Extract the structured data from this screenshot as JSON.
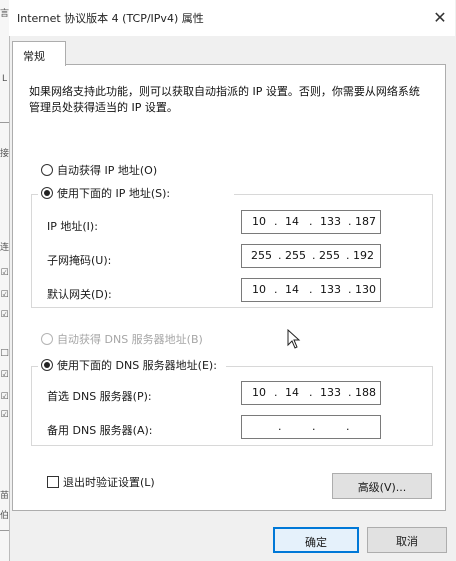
{
  "window": {
    "title": "Internet 协议版本 4 (TCP/IPv4) 属性",
    "close_glyph": "✕"
  },
  "tabs": [
    {
      "label": "常规"
    }
  ],
  "intro": "如果网络支持此功能，则可以获取自动指派的 IP 设置。否则，你需要从网络系统管理员处获得适当的 IP 设置。",
  "ip": {
    "auto_label": "自动获得 IP 地址(O)",
    "manual_label": "使用下面的 IP 地址(S):",
    "fields": [
      {
        "label": "IP 地址(I):",
        "octets": [
          "10",
          "14",
          "133",
          "187"
        ]
      },
      {
        "label": "子网掩码(U):",
        "octets": [
          "255",
          "255",
          "255",
          "192"
        ]
      },
      {
        "label": "默认网关(D):",
        "octets": [
          "10",
          "14",
          "133",
          "130"
        ]
      }
    ]
  },
  "dns": {
    "auto_label": "自动获得 DNS 服务器地址(B)",
    "manual_label": "使用下面的 DNS 服务器地址(E):",
    "fields": [
      {
        "label": "首选 DNS 服务器(P):",
        "octets": [
          "10",
          "14",
          "133",
          "188"
        ]
      },
      {
        "label": "备用 DNS 服务器(A):",
        "octets": [
          "",
          "",
          "",
          ""
        ]
      }
    ]
  },
  "validate_label": "退出时验证设置(L)",
  "buttons": {
    "advanced": "高级(V)...",
    "ok": "确定",
    "cancel": "取消"
  },
  "left_strip": {
    "glyphs": [
      "言",
      "L",
      "—",
      "接",
      "连",
      "☑",
      "☑",
      "☑",
      "□",
      "☑",
      "☑",
      "☑",
      "苗",
      "伯",
      "—"
    ]
  },
  "colors": {
    "accent": "#0078d7",
    "window_bg": "#f0f0f0"
  }
}
